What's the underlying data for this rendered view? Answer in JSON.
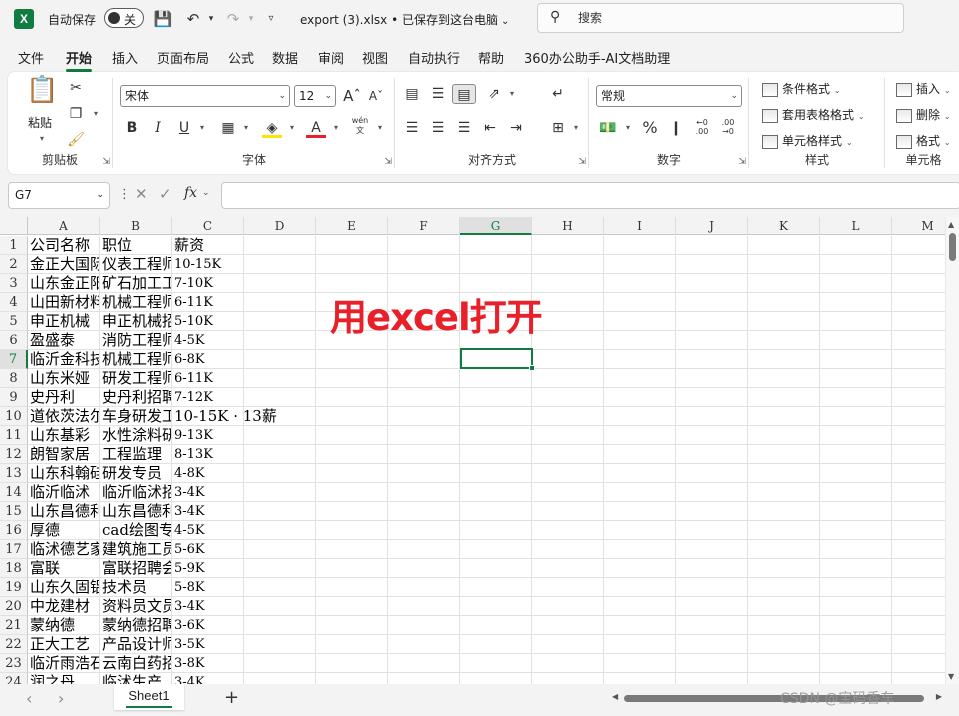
{
  "titlebar": {
    "app_logo": "X",
    "autosave_label": "自动保存",
    "autosave_state": "关",
    "filename": "export (3).xlsx • 已保存到这台电脑",
    "search_placeholder": "搜索"
  },
  "tabs": [
    {
      "label": "文件"
    },
    {
      "label": "开始"
    },
    {
      "label": "插入"
    },
    {
      "label": "页面布局"
    },
    {
      "label": "公式"
    },
    {
      "label": "数据"
    },
    {
      "label": "审阅"
    },
    {
      "label": "视图"
    },
    {
      "label": "自动执行"
    },
    {
      "label": "帮助"
    },
    {
      "label": "360办公助手-AI文档助理"
    }
  ],
  "active_tab": "开始",
  "ribbon": {
    "clipboard": {
      "label": "剪贴板",
      "paste": "粘贴"
    },
    "font": {
      "label": "字体",
      "font_name": "宋体",
      "font_size": "12",
      "phonetic": "wén"
    },
    "alignment": {
      "label": "对齐方式"
    },
    "number": {
      "label": "数字",
      "format": "常规"
    },
    "styles": {
      "label": "样式",
      "conditional": "条件格式",
      "table": "套用表格格式",
      "cell_styles": "单元格样式"
    },
    "cells": {
      "label": "单元格",
      "insert": "插入",
      "delete": "删除",
      "format": "格式"
    }
  },
  "formula_bar": {
    "name_box": "G7",
    "fx": "fx",
    "value": ""
  },
  "grid": {
    "columns": [
      "A",
      "B",
      "C",
      "D",
      "E",
      "F",
      "G",
      "H",
      "I",
      "J",
      "K",
      "L",
      "M"
    ],
    "selected_column": "G",
    "selected_row": 7,
    "selected_cell": "G7",
    "rows": [
      {
        "n": "1",
        "a": "公司名称",
        "b": "职位",
        "c": "薪资"
      },
      {
        "n": "2",
        "a": "金正大国际",
        "b": "仪表工程师",
        "c": "10-15K"
      },
      {
        "n": "3",
        "a": "山东金正阳",
        "b": "矿石加工工",
        "c": "7-10K"
      },
      {
        "n": "4",
        "a": "山田新材料",
        "b": "机械工程师",
        "c": "6-11K"
      },
      {
        "n": "5",
        "a": "申正机械",
        "b": "申正机械招",
        "c": "5-10K"
      },
      {
        "n": "6",
        "a": "盈盛泰",
        "b": "消防工程师",
        "c": "4-5K"
      },
      {
        "n": "7",
        "a": "临沂金科技",
        "b": "机械工程师",
        "c": "6-8K"
      },
      {
        "n": "8",
        "a": "山东米娅",
        "b": "研发工程师",
        "c": "6-11K"
      },
      {
        "n": "9",
        "a": "史丹利",
        "b": "史丹利招聘",
        "c": "7-12K"
      },
      {
        "n": "10",
        "a": "道依茨法尔",
        "b": "车身研发工",
        "c": "10-15K · 13薪"
      },
      {
        "n": "11",
        "a": "山东基彩",
        "b": "水性涂料研",
        "c": "9-13K"
      },
      {
        "n": "12",
        "a": "朗智家居",
        "b": "工程监理",
        "c": "8-13K"
      },
      {
        "n": "13",
        "a": "山东科翰硅",
        "b": "研发专员",
        "c": "4-8K"
      },
      {
        "n": "14",
        "a": "临沂临沭",
        "b": "临沂临沭招",
        "c": "3-4K"
      },
      {
        "n": "15",
        "a": "山东昌德利",
        "b": "山东昌德利",
        "c": "3-4K"
      },
      {
        "n": "16",
        "a": "厚德",
        "b": "cad绘图专员",
        "c": "4-5K"
      },
      {
        "n": "17",
        "a": "临沭德艺家",
        "b": "建筑施工员",
        "c": "5-6K"
      },
      {
        "n": "18",
        "a": "富联",
        "b": "富联招聘会",
        "c": "5-9K"
      },
      {
        "n": "19",
        "a": "山东久固铝",
        "b": "技术员",
        "c": "5-8K"
      },
      {
        "n": "20",
        "a": "中龙建材",
        "b": "资料员文员",
        "c": "3-4K"
      },
      {
        "n": "21",
        "a": "蒙纳德",
        "b": "蒙纳德招聘",
        "c": "3-6K"
      },
      {
        "n": "22",
        "a": "正大工艺",
        "b": "产品设计师",
        "c": "3-5K"
      },
      {
        "n": "23",
        "a": "临沂雨浩石",
        "b": "云南白药招",
        "c": "3-8K"
      },
      {
        "n": "24",
        "a": "润之丹",
        "b": "临沭生产",
        "c": "3-4K"
      }
    ],
    "overlay_text": "用excel打开"
  },
  "sheets": [
    {
      "label": "Sheet1"
    }
  ],
  "watermark": "CSDN @宝码香车",
  "colors": {
    "accent": "#107c41",
    "overlay": "#e8202a"
  }
}
